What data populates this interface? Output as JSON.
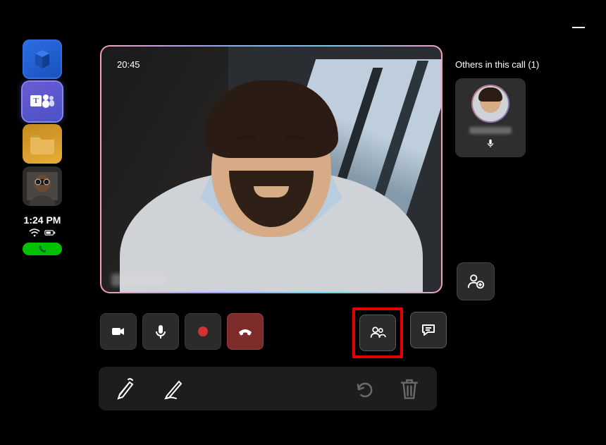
{
  "window": {
    "minimize_label": "Minimize"
  },
  "sidebar": {
    "apps": [
      {
        "id": "m365",
        "name": "Microsoft 365"
      },
      {
        "id": "teams",
        "name": "Teams",
        "badge_letter": "T"
      },
      {
        "id": "files",
        "name": "Files"
      },
      {
        "id": "avatar",
        "name": "User avatar"
      }
    ],
    "time": "1:24 PM",
    "wifi_label": "Wi-Fi",
    "battery_label": "Battery",
    "ongoing_call_label": "Ongoing call"
  },
  "call": {
    "duration": "20:45",
    "main_participant_name": "",
    "controls": {
      "camera": "Camera",
      "mic": "Microphone",
      "record": "Record",
      "hangup": "Hang up",
      "people": "People",
      "chat": "Chat"
    }
  },
  "others": {
    "title": "Others in this call (1)",
    "participants": [
      {
        "name": "",
        "mic_on": true
      }
    ],
    "add_people_label": "Add people"
  },
  "inkbar": {
    "undo_label": "Undo",
    "delete_label": "Delete",
    "pen_label": "Pen",
    "pencil_label": "Pencil"
  },
  "highlight": {
    "target": "people"
  }
}
